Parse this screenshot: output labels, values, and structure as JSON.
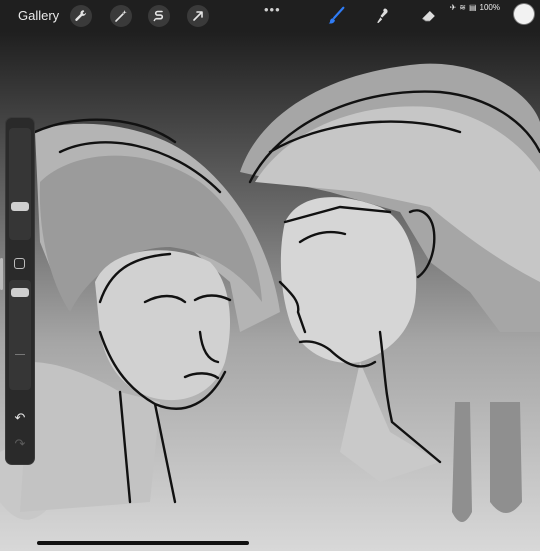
{
  "topbar": {
    "gallery_label": "Gallery",
    "more_label": "•••",
    "status": {
      "battery_text": "100%"
    },
    "tools": [
      "wrench-icon",
      "magic-wand-icon",
      "selection-icon",
      "transform-arrow-icon"
    ],
    "right_tools": [
      "brush-icon",
      "smudge-icon",
      "eraser-icon",
      "layers-icon"
    ],
    "active_tool": "brush-icon",
    "active_color": "#f2f2f2",
    "accent": "#2f7cf6"
  },
  "sidebar": {
    "brush_size_level": 0.25,
    "opacity_level": 0.5
  }
}
